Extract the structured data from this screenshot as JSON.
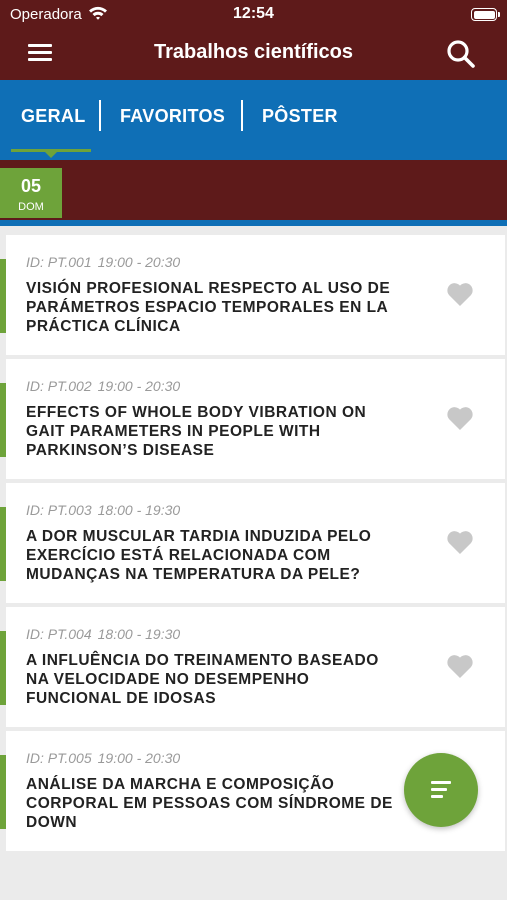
{
  "status_bar": {
    "carrier": "Operadora",
    "time": "12:54"
  },
  "app_bar": {
    "title": "Trabalhos científicos"
  },
  "tabs": [
    {
      "label": "GERAL",
      "active": true
    },
    {
      "label": "FAVORITOS",
      "active": false
    },
    {
      "label": "PÔSTER",
      "active": false
    }
  ],
  "date": {
    "day": "05",
    "weekday": "DOM"
  },
  "items": [
    {
      "id": "ID: PT.001",
      "time": "19:00 - 20:30",
      "title": "VISIÓN PROFESIONAL RESPECTO AL USO DE PARÁMETROS ESPACIO TEMPORALES EN LA PRÁCTICA CLÍNICA"
    },
    {
      "id": "ID: PT.002",
      "time": "19:00 - 20:30",
      "title": "EFFECTS OF WHOLE BODY VIBRATION ON GAIT PARAMETERS IN PEOPLE WITH PARKINSON’S DISEASE"
    },
    {
      "id": "ID: PT.003",
      "time": "18:00 - 19:30",
      "title": "A DOR MUSCULAR TARDIA INDUZIDA PELO EXERCÍCIO ESTÁ RELACIONADA COM MUDANÇAS NA TEMPERATURA DA PELE?"
    },
    {
      "id": "ID: PT.004",
      "time": "18:00 - 19:30",
      "title": "A INFLUÊNCIA DO TREINAMENTO BASEADO NA VELOCIDADE NO DESEMPENHO FUNCIONAL DE IDOSAS"
    },
    {
      "id": "ID: PT.005",
      "time": "19:00 - 20:30",
      "title": "ANÁLISE DA MARCHA E COMPOSIÇÃO CORPORAL EM PESSOAS COM SÍNDROME DE DOWN"
    }
  ],
  "colors": {
    "header": "#5e1a1a",
    "tabs": "#0f6fb6",
    "accent": "#6ea33a",
    "heart": "#c8c8c8"
  },
  "icons": [
    "wifi-icon",
    "battery-icon",
    "menu-icon",
    "search-icon",
    "heart-icon",
    "filter-icon"
  ]
}
